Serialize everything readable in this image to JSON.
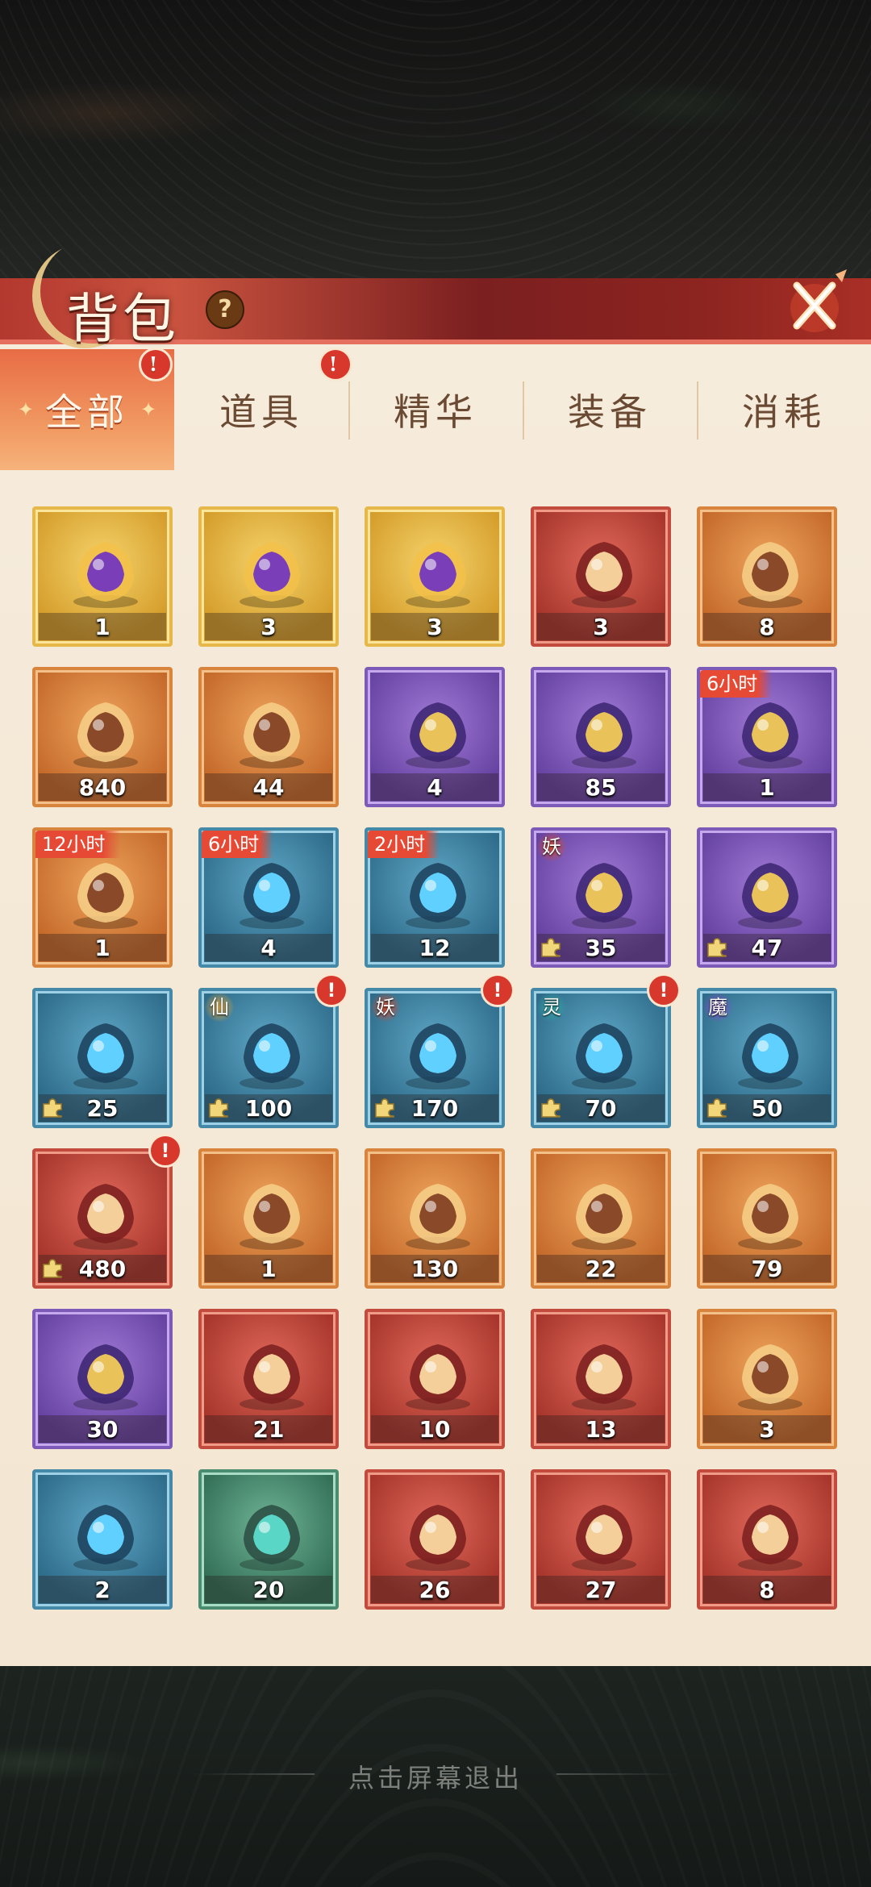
{
  "header": {
    "title": "背包",
    "help_label": "?"
  },
  "tabs": [
    {
      "label": "全部",
      "alert": true,
      "active": true
    },
    {
      "label": "道具",
      "alert": true,
      "active": false
    },
    {
      "label": "精华",
      "alert": false,
      "active": false
    },
    {
      "label": "装备",
      "alert": false,
      "active": false
    },
    {
      "label": "消耗",
      "alert": false,
      "active": false
    }
  ],
  "tab_deco": "✦",
  "alert_mark": "!",
  "items": [
    {
      "count": "1",
      "rarity": "gold",
      "icon": "purple-pouch-icon"
    },
    {
      "count": "3",
      "rarity": "gold",
      "icon": "card-chest-icon"
    },
    {
      "count": "3",
      "rarity": "gold",
      "icon": "treasure-chest-icon"
    },
    {
      "count": "3",
      "rarity": "red",
      "icon": "card-chest-icon"
    },
    {
      "count": "8",
      "rarity": "orange",
      "icon": "lucky-bag-icon"
    },
    {
      "count": "840",
      "rarity": "orange",
      "icon": "potion-basket-icon"
    },
    {
      "count": "44",
      "rarity": "orange",
      "icon": "treasure-book-icon"
    },
    {
      "count": "4",
      "rarity": "purple",
      "icon": "card-chest-icon"
    },
    {
      "count": "85",
      "rarity": "purple",
      "icon": "glowing-chest-icon"
    },
    {
      "count": "1",
      "rarity": "purple",
      "icon": "jade-chest-icon",
      "timer": "6小时"
    },
    {
      "count": "1",
      "rarity": "orange",
      "icon": "jade-chest-icon",
      "timer": "12小时"
    },
    {
      "count": "4",
      "rarity": "blue",
      "icon": "jade-bag-icon",
      "timer": "6小时"
    },
    {
      "count": "12",
      "rarity": "blue",
      "icon": "jade-pile-icon",
      "timer": "2小时"
    },
    {
      "count": "35",
      "rarity": "purple",
      "icon": "fire-spirit-icon",
      "badge": "妖",
      "piece": true
    },
    {
      "count": "47",
      "rarity": "purple",
      "icon": "purple-flame-icon",
      "piece": true
    },
    {
      "count": "25",
      "rarity": "blue",
      "icon": "blue-flame-icon",
      "piece": true
    },
    {
      "count": "100",
      "rarity": "blue",
      "icon": "golden-spirit-chest-icon",
      "badge": "仙",
      "piece": true,
      "alert": true
    },
    {
      "count": "170",
      "rarity": "blue",
      "icon": "red-spirit-chest-icon",
      "badge": "妖",
      "piece": true,
      "alert": true
    },
    {
      "count": "70",
      "rarity": "blue",
      "icon": "green-spirit-chest-icon",
      "badge": "灵",
      "piece": true,
      "alert": true
    },
    {
      "count": "50",
      "rarity": "blue",
      "icon": "purple-spirit-chest-icon",
      "badge": "魔",
      "piece": true
    },
    {
      "count": "480",
      "rarity": "red",
      "icon": "character-portrait-icon",
      "piece": true,
      "alert": true
    },
    {
      "count": "1",
      "rarity": "orange",
      "icon": "blue-crystal-icon"
    },
    {
      "count": "130",
      "rarity": "orange",
      "icon": "potion-bottle-icon"
    },
    {
      "count": "22",
      "rarity": "orange",
      "icon": "red-fruit-icon"
    },
    {
      "count": "79",
      "rarity": "orange",
      "icon": "scroll-icon"
    },
    {
      "count": "30",
      "rarity": "purple",
      "icon": "scroll-icon"
    },
    {
      "count": "21",
      "rarity": "red",
      "icon": "golden-staff-icon"
    },
    {
      "count": "10",
      "rarity": "red",
      "icon": "spear-icon"
    },
    {
      "count": "13",
      "rarity": "red",
      "icon": "dagger-icon"
    },
    {
      "count": "3",
      "rarity": "orange",
      "icon": "fire-gem-icon"
    },
    {
      "count": "2",
      "rarity": "blue",
      "icon": "ore-stone-icon"
    },
    {
      "count": "20",
      "rarity": "green",
      "icon": "rune-stone-icon"
    },
    {
      "count": "26",
      "rarity": "red",
      "icon": "salt-block-icon"
    },
    {
      "count": "27",
      "rarity": "red",
      "icon": "flame-orb-icon"
    },
    {
      "count": "8",
      "rarity": "red",
      "icon": "feather-swirl-icon"
    }
  ],
  "footer": {
    "exit_text": "点击屏幕退出"
  },
  "colors": {
    "header_red": "#b3382f",
    "tab_active": "#e86c46",
    "alert_red": "#d8382c",
    "timer_red": "#e64a35"
  }
}
